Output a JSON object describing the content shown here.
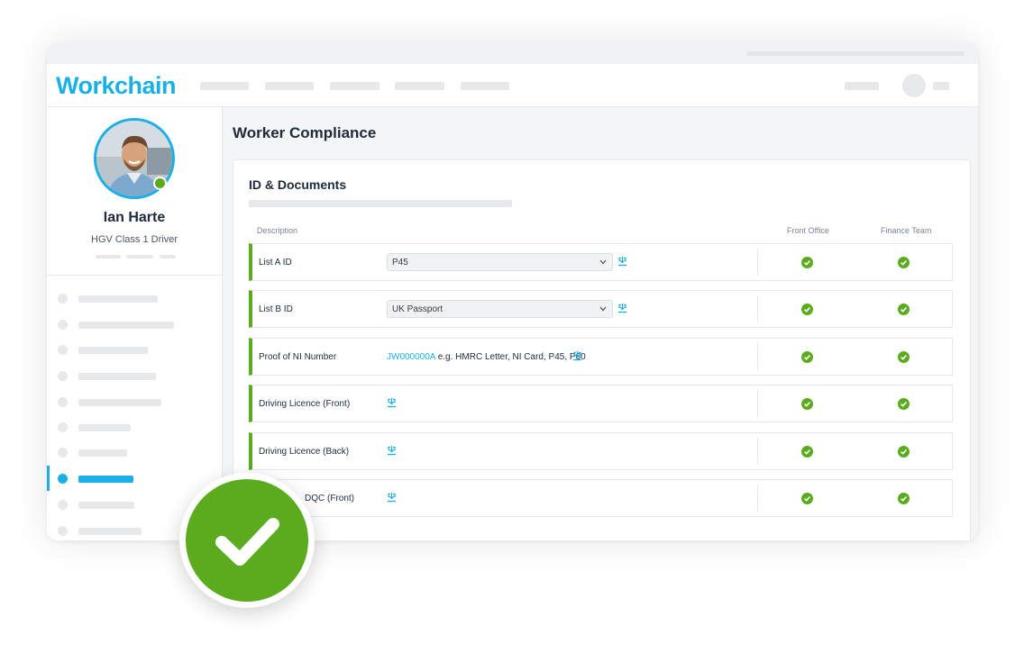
{
  "app": {
    "logo": "Workchain"
  },
  "profile": {
    "name": "Ian Harte",
    "role": "HGV Class 1 Driver",
    "status": "online"
  },
  "page": {
    "title": "Worker Compliance"
  },
  "card": {
    "title": "ID & Documents",
    "columns": {
      "description": "Description",
      "front_office": "Front Office",
      "finance_team": "Finance Team"
    }
  },
  "rows": [
    {
      "label": "List A ID",
      "select_value": "P45",
      "front_office": "approved",
      "finance_team": "approved"
    },
    {
      "label": "List B ID",
      "select_value": "UK Passport",
      "front_office": "approved",
      "finance_team": "approved"
    },
    {
      "label": "Proof of NI Number",
      "ni_number": "JW000000A",
      "hint": "e.g. HMRC Letter, NI Card, P45, P60",
      "front_office": "approved",
      "finance_team": "approved"
    },
    {
      "label": "Driving Licence (Front)",
      "front_office": "approved",
      "finance_team": "approved"
    },
    {
      "label": "Driving Licence (Back)",
      "front_office": "approved",
      "finance_team": "approved"
    },
    {
      "label": "DQC (Front)",
      "front_office": "approved",
      "finance_team": "approved"
    }
  ],
  "icons": {
    "download": "download-icon",
    "check": "check-circle-icon",
    "chevron": "chevron-down-icon",
    "badge": "big-checkmark-icon"
  },
  "colors": {
    "brand": "#1ab0e6",
    "success": "#5aab1e"
  }
}
